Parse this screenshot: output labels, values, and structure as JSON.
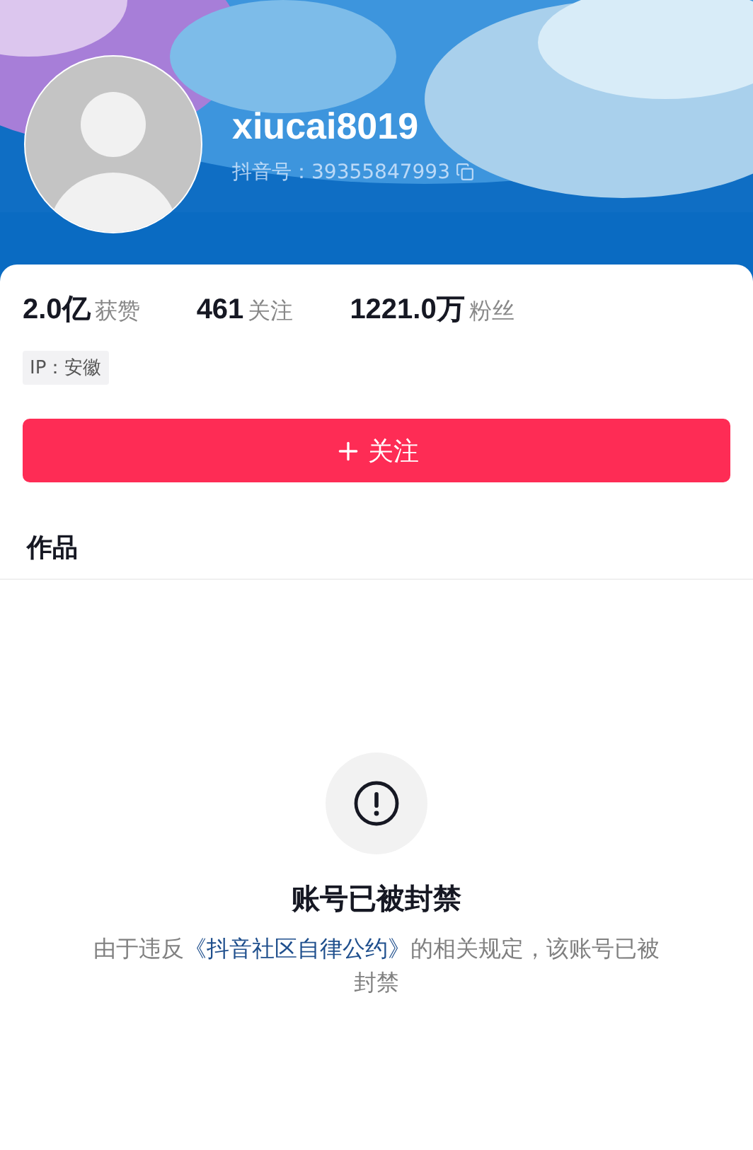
{
  "profile": {
    "kind": "picture",
    "username": "xiucai8019",
    "id_label": "抖音号：39355847993"
  },
  "stats": [
    {
      "value": "2.0亿",
      "label": "获赞"
    },
    {
      "value": "461",
      "label": "关注"
    },
    {
      "value": "1221.0万",
      "label": "粉丝"
    }
  ],
  "ip_tag": "IP：安徽",
  "follow_button": {
    "label": "关注"
  },
  "tabs": [
    {
      "label": "作品"
    }
  ],
  "notice": {
    "title": "账号已被封禁",
    "before": "由于违反",
    "link": "《抖音社区自律公约》",
    "after": "的相关规定，该账号已被封禁"
  }
}
